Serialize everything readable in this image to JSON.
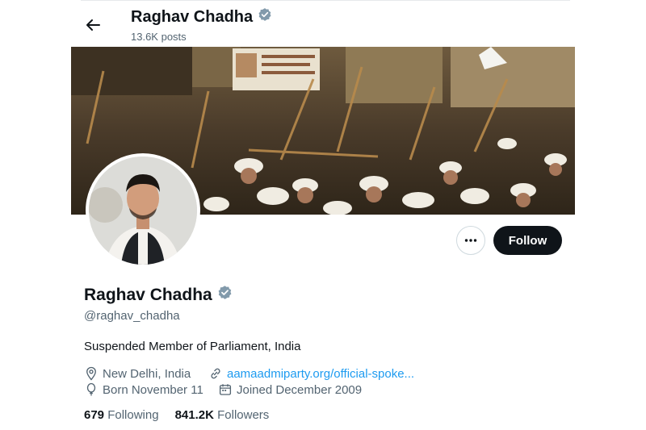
{
  "header": {
    "name": "Raghav Chadha",
    "posts": "13.6K posts"
  },
  "profile": {
    "name": "Raghav Chadha",
    "handle": "@raghav_chadha",
    "bio": "Suspended Member of Parliament, India",
    "location": "New Delhi, India",
    "website": "aamaadmiparty.org/official-spoke...",
    "birthday": "Born November 11",
    "joined": "Joined December 2009"
  },
  "stats": {
    "following_count": "679",
    "following_label": "Following",
    "followers_count": "841.2K",
    "followers_label": "Followers"
  },
  "actions": {
    "follow_label": "Follow",
    "more_icon": "more-horizontal-icon"
  },
  "colors": {
    "verified": "#829aab",
    "link": "#1d9bf0",
    "follow_bg": "#0f1419",
    "secondary_text": "#536471"
  }
}
